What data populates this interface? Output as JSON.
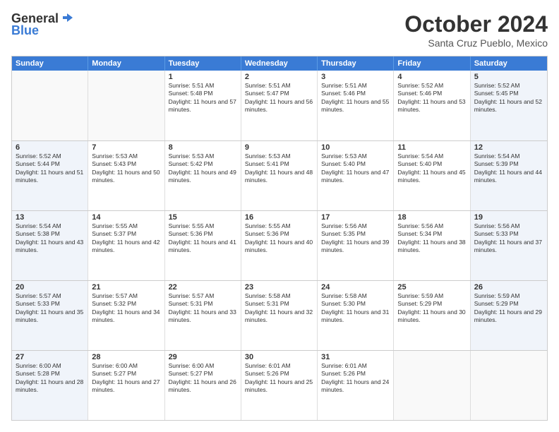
{
  "header": {
    "logo_general": "General",
    "logo_blue": "Blue",
    "month_title": "October 2024",
    "location": "Santa Cruz Pueblo, Mexico"
  },
  "days_of_week": [
    "Sunday",
    "Monday",
    "Tuesday",
    "Wednesday",
    "Thursday",
    "Friday",
    "Saturday"
  ],
  "weeks": [
    [
      {
        "day": "",
        "info": ""
      },
      {
        "day": "",
        "info": ""
      },
      {
        "day": "1",
        "info": "Sunrise: 5:51 AM\nSunset: 5:48 PM\nDaylight: 11 hours and 57 minutes."
      },
      {
        "day": "2",
        "info": "Sunrise: 5:51 AM\nSunset: 5:47 PM\nDaylight: 11 hours and 56 minutes."
      },
      {
        "day": "3",
        "info": "Sunrise: 5:51 AM\nSunset: 5:46 PM\nDaylight: 11 hours and 55 minutes."
      },
      {
        "day": "4",
        "info": "Sunrise: 5:52 AM\nSunset: 5:46 PM\nDaylight: 11 hours and 53 minutes."
      },
      {
        "day": "5",
        "info": "Sunrise: 5:52 AM\nSunset: 5:45 PM\nDaylight: 11 hours and 52 minutes."
      }
    ],
    [
      {
        "day": "6",
        "info": "Sunrise: 5:52 AM\nSunset: 5:44 PM\nDaylight: 11 hours and 51 minutes."
      },
      {
        "day": "7",
        "info": "Sunrise: 5:53 AM\nSunset: 5:43 PM\nDaylight: 11 hours and 50 minutes."
      },
      {
        "day": "8",
        "info": "Sunrise: 5:53 AM\nSunset: 5:42 PM\nDaylight: 11 hours and 49 minutes."
      },
      {
        "day": "9",
        "info": "Sunrise: 5:53 AM\nSunset: 5:41 PM\nDaylight: 11 hours and 48 minutes."
      },
      {
        "day": "10",
        "info": "Sunrise: 5:53 AM\nSunset: 5:40 PM\nDaylight: 11 hours and 47 minutes."
      },
      {
        "day": "11",
        "info": "Sunrise: 5:54 AM\nSunset: 5:40 PM\nDaylight: 11 hours and 45 minutes."
      },
      {
        "day": "12",
        "info": "Sunrise: 5:54 AM\nSunset: 5:39 PM\nDaylight: 11 hours and 44 minutes."
      }
    ],
    [
      {
        "day": "13",
        "info": "Sunrise: 5:54 AM\nSunset: 5:38 PM\nDaylight: 11 hours and 43 minutes."
      },
      {
        "day": "14",
        "info": "Sunrise: 5:55 AM\nSunset: 5:37 PM\nDaylight: 11 hours and 42 minutes."
      },
      {
        "day": "15",
        "info": "Sunrise: 5:55 AM\nSunset: 5:36 PM\nDaylight: 11 hours and 41 minutes."
      },
      {
        "day": "16",
        "info": "Sunrise: 5:55 AM\nSunset: 5:36 PM\nDaylight: 11 hours and 40 minutes."
      },
      {
        "day": "17",
        "info": "Sunrise: 5:56 AM\nSunset: 5:35 PM\nDaylight: 11 hours and 39 minutes."
      },
      {
        "day": "18",
        "info": "Sunrise: 5:56 AM\nSunset: 5:34 PM\nDaylight: 11 hours and 38 minutes."
      },
      {
        "day": "19",
        "info": "Sunrise: 5:56 AM\nSunset: 5:33 PM\nDaylight: 11 hours and 37 minutes."
      }
    ],
    [
      {
        "day": "20",
        "info": "Sunrise: 5:57 AM\nSunset: 5:33 PM\nDaylight: 11 hours and 35 minutes."
      },
      {
        "day": "21",
        "info": "Sunrise: 5:57 AM\nSunset: 5:32 PM\nDaylight: 11 hours and 34 minutes."
      },
      {
        "day": "22",
        "info": "Sunrise: 5:57 AM\nSunset: 5:31 PM\nDaylight: 11 hours and 33 minutes."
      },
      {
        "day": "23",
        "info": "Sunrise: 5:58 AM\nSunset: 5:31 PM\nDaylight: 11 hours and 32 minutes."
      },
      {
        "day": "24",
        "info": "Sunrise: 5:58 AM\nSunset: 5:30 PM\nDaylight: 11 hours and 31 minutes."
      },
      {
        "day": "25",
        "info": "Sunrise: 5:59 AM\nSunset: 5:29 PM\nDaylight: 11 hours and 30 minutes."
      },
      {
        "day": "26",
        "info": "Sunrise: 5:59 AM\nSunset: 5:29 PM\nDaylight: 11 hours and 29 minutes."
      }
    ],
    [
      {
        "day": "27",
        "info": "Sunrise: 6:00 AM\nSunset: 5:28 PM\nDaylight: 11 hours and 28 minutes."
      },
      {
        "day": "28",
        "info": "Sunrise: 6:00 AM\nSunset: 5:27 PM\nDaylight: 11 hours and 27 minutes."
      },
      {
        "day": "29",
        "info": "Sunrise: 6:00 AM\nSunset: 5:27 PM\nDaylight: 11 hours and 26 minutes."
      },
      {
        "day": "30",
        "info": "Sunrise: 6:01 AM\nSunset: 5:26 PM\nDaylight: 11 hours and 25 minutes."
      },
      {
        "day": "31",
        "info": "Sunrise: 6:01 AM\nSunset: 5:26 PM\nDaylight: 11 hours and 24 minutes."
      },
      {
        "day": "",
        "info": ""
      },
      {
        "day": "",
        "info": ""
      }
    ]
  ]
}
